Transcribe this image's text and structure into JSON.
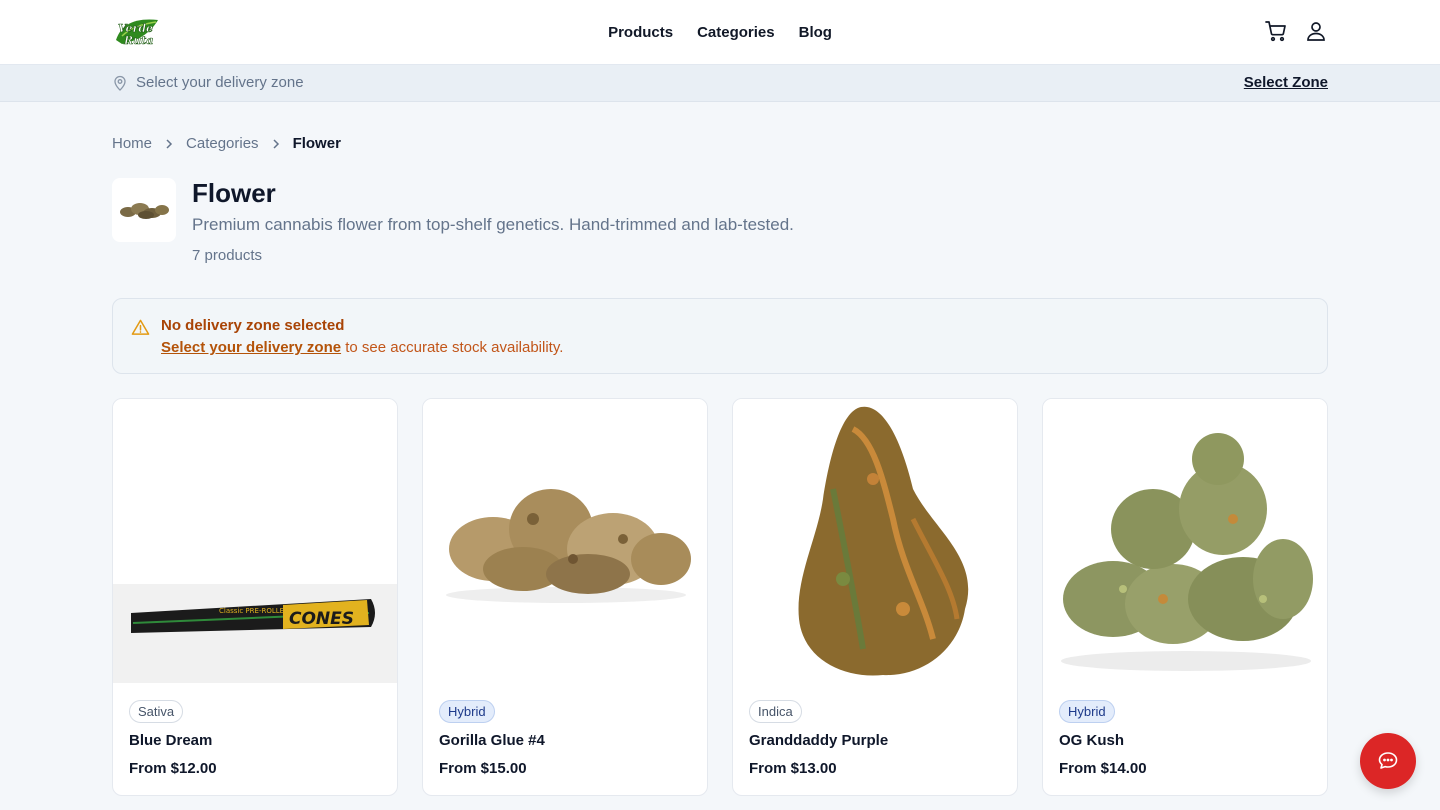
{
  "brand": {
    "logo_text_top": "Verde",
    "logo_text_bottom": "Ruta",
    "accent": "#dc2626"
  },
  "nav": {
    "items": [
      "Products",
      "Categories",
      "Blog"
    ]
  },
  "header_icons": [
    "cart-icon",
    "user-icon"
  ],
  "zone_bar": {
    "text": "Select your delivery zone",
    "action": "Select Zone"
  },
  "breadcrumb": {
    "items": [
      "Home",
      "Categories",
      "Flower"
    ]
  },
  "category": {
    "title": "Flower",
    "description": "Premium cannabis flower from top-shelf genetics. Hand-trimmed and lab-tested.",
    "count": "7 products"
  },
  "alert": {
    "title": "No delivery zone selected",
    "link": "Select your delivery zone",
    "body": " to see accurate stock availability."
  },
  "products": [
    {
      "type": "Sativa",
      "name": "Blue Dream",
      "price": "From $12.00",
      "image_label": "CONES",
      "image_sublabel": "Classic PRE-ROLLED"
    },
    {
      "type": "Hybrid",
      "name": "Gorilla Glue #4",
      "price": "From $15.00"
    },
    {
      "type": "Indica",
      "name": "Granddaddy Purple",
      "price": "From $13.00"
    },
    {
      "type": "Hybrid",
      "name": "OG Kush",
      "price": "From $14.00"
    }
  ],
  "chat": {
    "icon": "chat-icon"
  }
}
